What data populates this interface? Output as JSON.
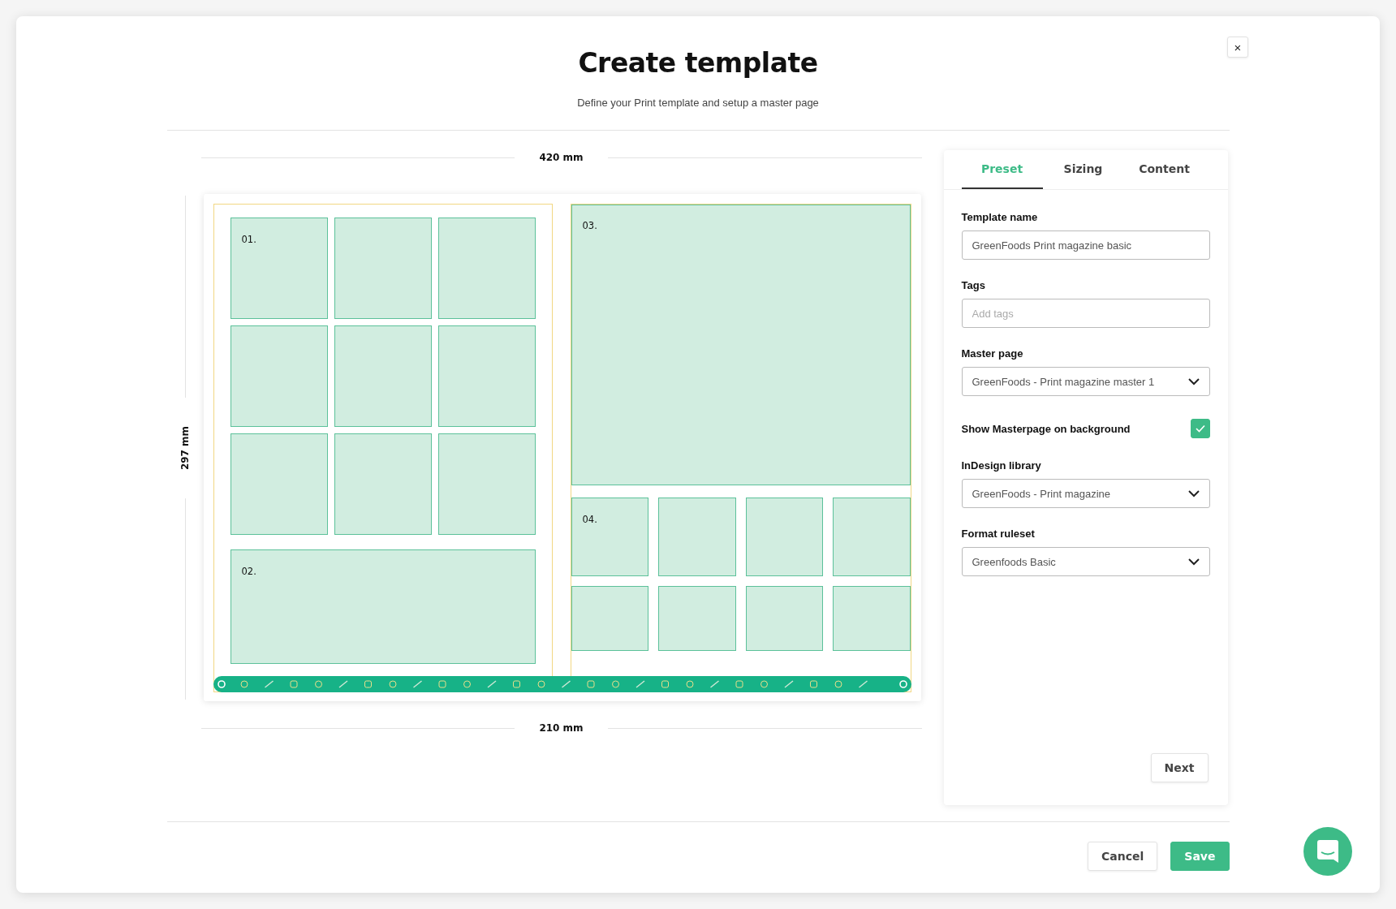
{
  "dialog": {
    "title": "Create template",
    "subtitle": "Define your Print template and setup a master page",
    "close_label": "×"
  },
  "canvas": {
    "width_label": "420 mm",
    "height_label": "297 mm",
    "bottom_label": "210 mm",
    "pages": [
      {
        "sections": [
          {
            "kind": "grid",
            "label": "01."
          },
          {
            "kind": "block",
            "label": "02."
          }
        ]
      },
      {
        "sections": [
          {
            "kind": "block",
            "label": "03."
          },
          {
            "kind": "grid",
            "label": "04."
          }
        ]
      }
    ]
  },
  "panel": {
    "tabs": [
      {
        "label": "Preset",
        "selected": true
      },
      {
        "label": "Sizing",
        "selected": false
      },
      {
        "label": "Content",
        "selected": false
      }
    ],
    "fields": [
      {
        "kind": "text",
        "label": "Template name",
        "value": "GreenFoods Print magazine basic"
      },
      {
        "kind": "text",
        "label": "Tags",
        "placeholder": "Add tags"
      },
      {
        "kind": "select",
        "label": "Master page",
        "value": "GreenFoods - Print magazine master 1"
      },
      {
        "kind": "checkbox",
        "label": "Show Masterpage on background",
        "checked": true
      },
      {
        "kind": "select",
        "label": "InDesign library",
        "value": "GreenFoods - Print magazine"
      },
      {
        "kind": "select",
        "label": "Format ruleset",
        "value": "Greenfoods Basic"
      }
    ],
    "next_button": "Next"
  },
  "footer": {
    "buttons": [
      {
        "label": "Cancel",
        "kind": "secondary"
      },
      {
        "label": "Save",
        "kind": "primary"
      }
    ]
  }
}
